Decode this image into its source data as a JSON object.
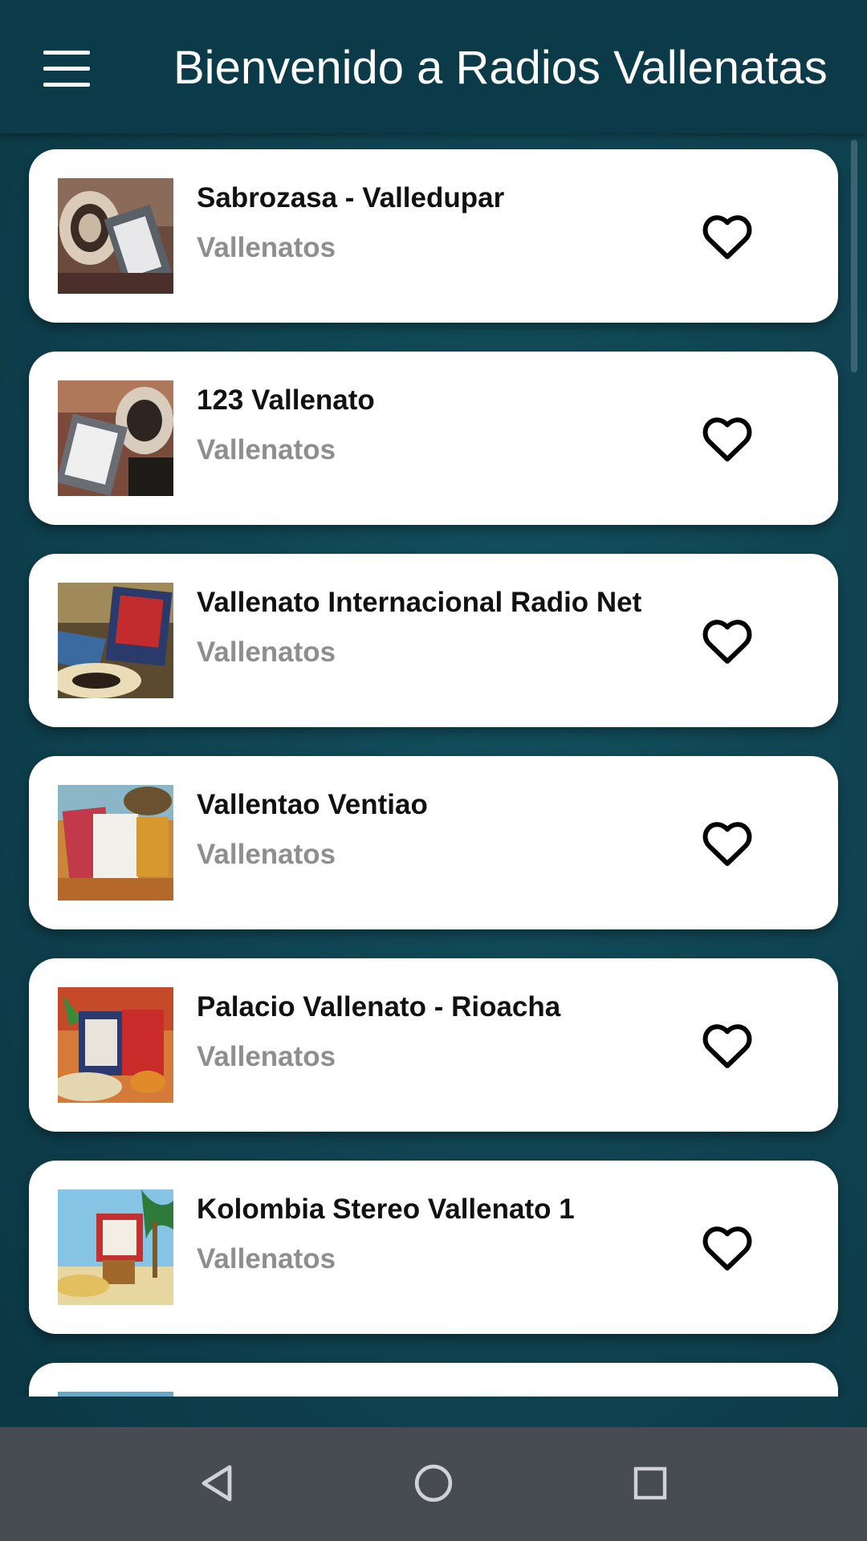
{
  "appbar": {
    "title": "Bienvenido a Radios Vallenatas",
    "menu_icon": "hamburger-menu-icon"
  },
  "stations": [
    {
      "name": "Sabrozasa - Valledupar",
      "genre": "Vallenatos",
      "favorite": false
    },
    {
      "name": "123 Vallenato",
      "genre": "Vallenatos",
      "favorite": false
    },
    {
      "name": "Vallenato Internacional Radio Net",
      "genre": "Vallenatos",
      "favorite": false
    },
    {
      "name": "Vallentao Ventiao",
      "genre": "Vallenatos",
      "favorite": false
    },
    {
      "name": "Palacio Vallenato - Rioacha",
      "genre": "Vallenatos",
      "favorite": false
    },
    {
      "name": "Kolombia Stereo Vallenato 1",
      "genre": "Vallenatos",
      "favorite": false
    }
  ],
  "icons": {
    "favorite": "heart-outline-icon",
    "back": "back-triangle-icon",
    "home": "home-circle-icon",
    "recents": "recents-square-icon"
  },
  "colors": {
    "appbar": "#0b3a48",
    "background": "#0f4250",
    "card": "#ffffff",
    "genre_text": "#8e8e8e",
    "navbar": "#474c52"
  }
}
